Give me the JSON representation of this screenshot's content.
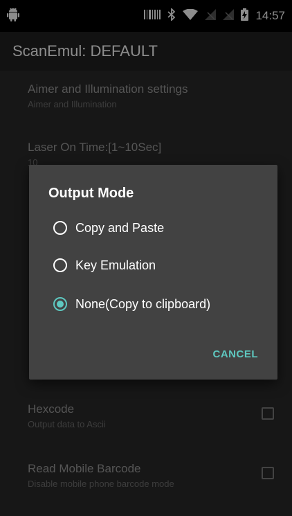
{
  "status_bar": {
    "time": "14:57",
    "icons": [
      "android-icon",
      "barcode-icon",
      "bluetooth-icon",
      "wifi-icon",
      "no-sim-icon",
      "no-sim-icon",
      "battery-charging-icon"
    ]
  },
  "app_bar": {
    "title": "ScanEmul: DEFAULT"
  },
  "preferences": [
    {
      "title": "Aimer and Illumination settings",
      "summary": "Aimer and Illumination"
    },
    {
      "title": "Laser On Time:[1~10Sec]",
      "summary": "10"
    },
    {
      "title": "Hexcode",
      "summary": "Output data to Ascii",
      "checked": false
    },
    {
      "title": "Read Mobile Barcode",
      "summary": "Disable mobile phone barcode mode",
      "checked": false
    }
  ],
  "dialog": {
    "title": "Output Mode",
    "options": [
      {
        "label": "Copy and Paste",
        "selected": false
      },
      {
        "label": "Key Emulation",
        "selected": false
      },
      {
        "label": "None(Copy to clipboard)",
        "selected": true
      }
    ],
    "cancel_label": "CANCEL"
  },
  "colors": {
    "accent": "#5ec8c0",
    "dialog_bg": "#424242",
    "background": "#2b2b2b"
  }
}
